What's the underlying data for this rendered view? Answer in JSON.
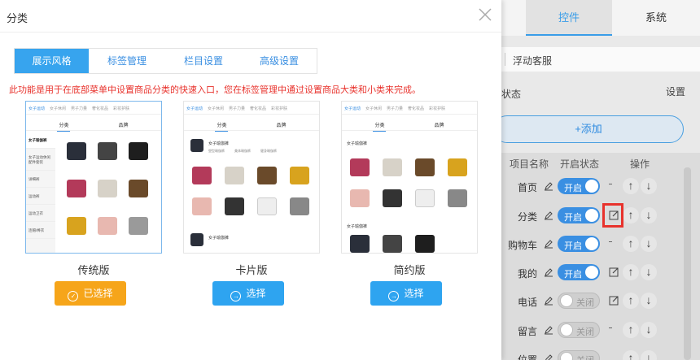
{
  "background": {
    "tabs": {
      "controls": "控件",
      "system": "系统"
    },
    "float_service": "浮动客服",
    "status_label": "状态",
    "settings_label": "设置",
    "add_button": "+添加",
    "table": {
      "headers": {
        "name": "项目名称",
        "status": "开启状态",
        "ops": "操作"
      },
      "rows": [
        {
          "name": "首页",
          "status": "开启",
          "on": true,
          "edit": false
        },
        {
          "name": "分类",
          "status": "开启",
          "on": true,
          "edit": true
        },
        {
          "name": "购物车",
          "status": "开启",
          "on": true,
          "edit": false
        },
        {
          "name": "我的",
          "status": "开启",
          "on": true,
          "edit": true
        },
        {
          "name": "电话",
          "status": "关闭",
          "on": false,
          "edit": true
        },
        {
          "name": "留言",
          "status": "关闭",
          "on": false,
          "edit": false
        },
        {
          "name": "位置",
          "status": "关闭",
          "on": false,
          "edit": false
        }
      ]
    }
  },
  "dialog": {
    "title": "分类",
    "tabs": [
      "展示风格",
      "标签管理",
      "栏目设置",
      "高级设置"
    ],
    "notice": "此功能是用于在底部菜单中设置商品分类的快速入口，您在标签管理中通过设置商品大类和小类来完成。",
    "styles": [
      {
        "label": "传统版",
        "button": "已选择",
        "selected": true
      },
      {
        "label": "卡片版",
        "button": "选择",
        "selected": false
      },
      {
        "label": "简约版",
        "button": "选择",
        "selected": false
      }
    ],
    "preview": {
      "top_tabs": [
        "女子运动",
        "女子休闲",
        "男子力量",
        "奢化妆品",
        "彩妆护肤"
      ],
      "sub_tabs": [
        "分类",
        "品牌"
      ],
      "side_items": [
        "女子瑜伽裤",
        "女子运动休闲配件套装",
        "详细裤",
        "运动裤",
        "运动卫衣",
        "连帽/棒衣"
      ],
      "group_title": "女子瑜伽裤",
      "chips": [
        "塑型瑜伽裤",
        "美体瑜伽裤",
        "健身瑜伽裤"
      ],
      "item_label": "塑型瑜伽裤"
    }
  },
  "colors": {
    "accent": "#37a4ee",
    "selected": "#f6a51a",
    "warning": "#e8322c"
  }
}
